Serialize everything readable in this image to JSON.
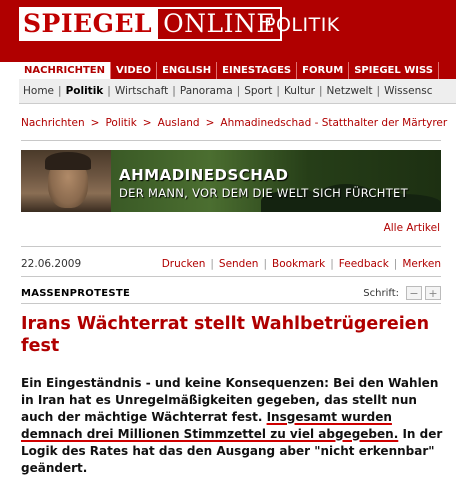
{
  "header": {
    "logo_left": "SPIEGEL",
    "logo_right": "ONLINE",
    "section": "POLITIK"
  },
  "nav_main": [
    "NACHRICHTEN",
    "VIDEO",
    "ENGLISH",
    "EINESTAGES",
    "FORUM",
    "SPIEGEL WISS"
  ],
  "nav_sub": [
    "Home",
    "Politik",
    "Wirtschaft",
    "Panorama",
    "Sport",
    "Kultur",
    "Netzwelt",
    "Wissensc"
  ],
  "breadcrumb": [
    "Nachrichten",
    "Politik",
    "Ausland",
    "Ahmadinedschad - Statthalter der Märtyrer"
  ],
  "banner": {
    "title": "AHMADINEDSCHAD",
    "subtitle": "DER MANN, VOR DEM DIE WELT SICH FÜRCHTET"
  },
  "all_articles": "Alle Artikel",
  "article_tools": {
    "date": "22.06.2009",
    "links": [
      "Drucken",
      "Senden",
      "Bookmark",
      "Feedback",
      "Merken"
    ]
  },
  "kicker": "MASSENPROTESTE",
  "font_control": {
    "label": "Schrift:",
    "minus": "−",
    "plus": "+"
  },
  "headline": "Irans Wächterrat stellt Wahlbetrügereien fest",
  "teaser": {
    "part1": "Ein Eingeständnis - und keine Konsequenzen: Bei den Wahlen in Iran hat es Unregelmäßigkeiten gegeben, das stellt nun auch der mächtige Wächterrat fest. ",
    "underlined": "Insgesamt wurden demnach drei Millionen Stimmzettel zu viel abgegeben.",
    "part2": " In der Logik des Rates hat das den Ausgang aber \"nicht erkennbar\" geändert."
  }
}
